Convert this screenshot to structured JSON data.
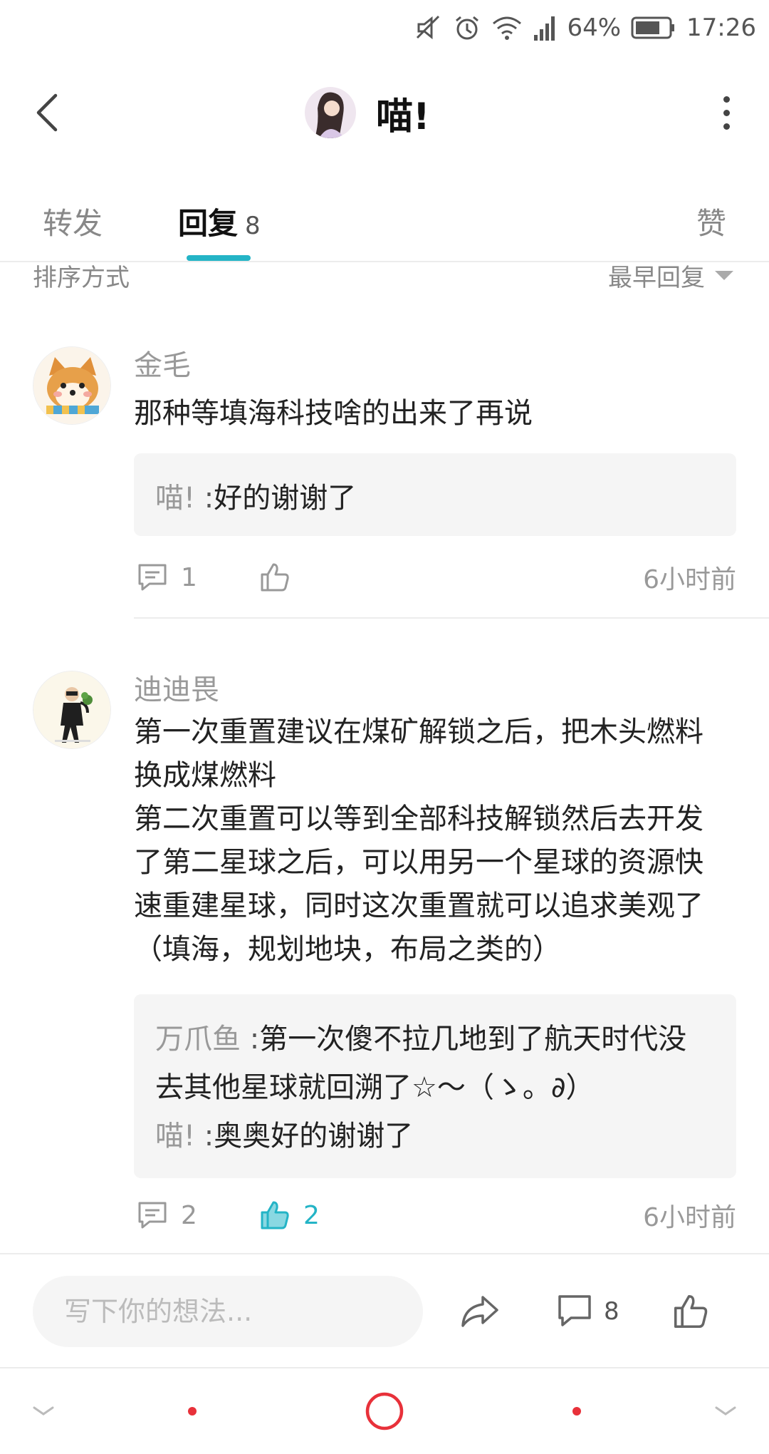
{
  "status_bar": {
    "battery": "64%",
    "time": "17:26"
  },
  "header": {
    "title": "喵!"
  },
  "tabs": {
    "forward_label": "转发",
    "reply_label": "回复",
    "reply_count": "8",
    "like_label": "赞"
  },
  "sort": {
    "label": "排序方式",
    "value": "最早回复"
  },
  "comments": [
    {
      "author": "金毛",
      "text": "那种等填海科技啥的出来了再说",
      "replies": [
        {
          "author": "喵!",
          "sep": ":",
          "text": "好的谢谢了"
        }
      ],
      "reply_count": "1",
      "like_count": "",
      "time": "6小时前"
    },
    {
      "author": "迪迪畏",
      "text_lines": [
        "第一次重置建议在煤矿解锁之后，把木头燃料",
        "换成煤燃料",
        "第二次重置可以等到全部科技解锁然后去开发",
        "了第二星球之后，可以用另一个星球的资源快",
        "速重建星球，同时这次重置就可以追求美观了",
        "（填海，规划地块，布局之类的）"
      ],
      "replies": [
        {
          "author": "万爪鱼",
          "sep": ":",
          "line1": "第一次傻不拉几地到了航天时代没",
          "line2": "去其他星球就回溯了☆～（ゝ。∂）"
        },
        {
          "author": "喵!",
          "sep": ":",
          "text": "奥奥好的谢谢了"
        }
      ],
      "reply_count": "2",
      "like_count": "2",
      "time": "6小时前"
    }
  ],
  "composer": {
    "placeholder": "写下你的想法...",
    "comment_count": "8"
  },
  "colors": {
    "accent": "#24b4c6",
    "nav_red": "#e8313a"
  }
}
